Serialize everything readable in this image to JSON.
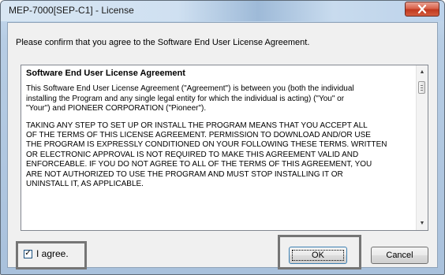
{
  "window": {
    "title": "MEP-7000[SEP-C1] - License",
    "close_icon": "close-x-icon"
  },
  "prompt": "Please confirm that you agree to the Software End User License Agreement.",
  "eula": {
    "heading": "Software End User License Agreement",
    "paragraph1": "This Software End User License Agreement (\"Agreement\") is between you (both the individual\ninstalling the Program and any single legal entity for which the individual is acting) (\"You\" or\n\"Your\") and PIONEER CORPORATION (\"Pioneer\").",
    "paragraph2": "TAKING ANY STEP TO SET UP OR INSTALL THE PROGRAM MEANS THAT YOU ACCEPT ALL\nOF THE TERMS OF THIS LICENSE AGREEMENT. PERMISSION TO DOWNLOAD AND/OR USE\nTHE PROGRAM IS EXPRESSLY CONDITIONED ON YOUR FOLLOWING THESE TERMS. WRITTEN\nOR ELECTRONIC APPROVAL IS NOT REQUIRED TO MAKE THIS AGREEMENT VALID AND\nENFORCEABLE. IF YOU DO NOT AGREE TO ALL OF THE TERMS OF THIS AGREEMENT, YOU\nARE NOT AUTHORIZED TO USE THE PROGRAM AND MUST STOP INSTALLING IT OR\nUNINSTALL IT, AS APPLICABLE."
  },
  "agree": {
    "label": "I agree.",
    "checked": true,
    "check_mark": "✓"
  },
  "buttons": {
    "ok": "OK",
    "cancel": "Cancel"
  },
  "colors": {
    "highlight_frame": "#757575",
    "close_button": "#c0391f"
  }
}
